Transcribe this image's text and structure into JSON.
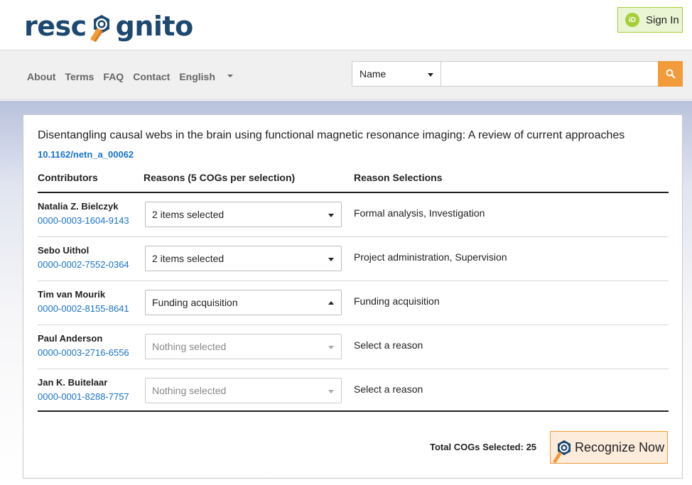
{
  "header": {
    "logo_left": "resc",
    "logo_right": "gnito",
    "signin_label": "Sign In",
    "orcid_badge": "iD"
  },
  "nav": {
    "items": [
      "About",
      "Terms",
      "FAQ",
      "Contact"
    ],
    "language": "English",
    "search_type": "Name",
    "search_value": ""
  },
  "article": {
    "title": "Disentangling causal webs in the brain using functional magnetic resonance imaging: A review of current approaches",
    "doi": "10.1162/netn_a_00062"
  },
  "table": {
    "headers": [
      "Contributors",
      "Reasons (5 COGs per selection)",
      "Reason Selections"
    ],
    "rows": [
      {
        "name": "Natalia Z. Bielczyk",
        "orcid": "0000-0003-1604-9143",
        "select": "2 items selected",
        "reasons": "Formal analysis, Investigation"
      },
      {
        "name": "Sebo Uithol",
        "orcid": "0000-0002-7552-0364",
        "select": "2 items selected",
        "reasons": "Project administration, Supervision"
      },
      {
        "name": "Tim van Mourik",
        "orcid": "0000-0002-8155-8641",
        "select": "Funding acquisition",
        "reasons": "Funding acquisition"
      },
      {
        "name": "Paul Anderson",
        "orcid": "0000-0003-2716-6556",
        "select": "Nothing selected",
        "reasons": "Select a reason"
      },
      {
        "name": "Jan K. Buitelaar",
        "orcid": "0000-0001-8288-7757",
        "select": "Nothing selected",
        "reasons": "Select a reason"
      }
    ]
  },
  "footer": {
    "total_label": "Total COGs Selected: 25",
    "recognize_label": "Recognize Now"
  },
  "colors": {
    "brand_navy": "#1d4870",
    "link_blue": "#1a73c8",
    "accent_orange": "#f29b3b",
    "orcid_green": "#a6ce39"
  }
}
